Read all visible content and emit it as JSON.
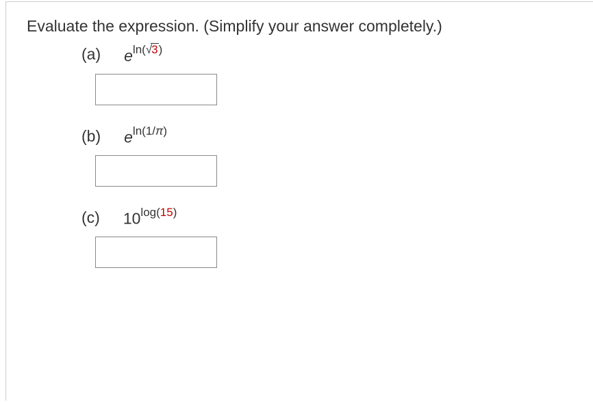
{
  "instruction": "Evaluate the expression. (Simplify your answer completely.)",
  "parts": {
    "a": {
      "label": "(a)",
      "base": "e",
      "exp_fn": "ln",
      "exp_lparen": "(",
      "exp_sqrt_sym": "√",
      "exp_sqrt_arg": "3",
      "exp_rparen": ")",
      "answer": ""
    },
    "b": {
      "label": "(b)",
      "base": "e",
      "exp_fn": "ln",
      "exp_lparen": "(",
      "exp_num": "1/",
      "exp_pi": "π",
      "exp_rparen": ")",
      "answer": ""
    },
    "c": {
      "label": "(c)",
      "base": "10",
      "exp_fn": "log",
      "exp_lparen": "(",
      "exp_num": "15",
      "exp_rparen": ")",
      "answer": ""
    }
  }
}
